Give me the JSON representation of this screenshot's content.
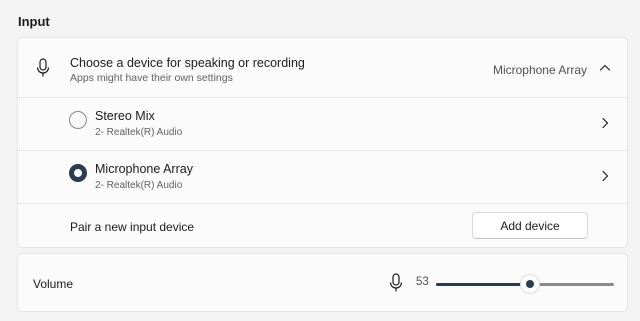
{
  "section": {
    "title": "Input"
  },
  "device_select": {
    "title": "Choose a device for speaking or recording",
    "subtitle": "Apps might have their own settings",
    "selected_value": "Microphone Array"
  },
  "devices": [
    {
      "name": "Stereo Mix",
      "detail": "2- Realtek(R) Audio",
      "selected": false
    },
    {
      "name": "Microphone Array",
      "detail": "2- Realtek(R) Audio",
      "selected": true
    }
  ],
  "pair": {
    "label": "Pair a new input device",
    "button_label": "Add device"
  },
  "volume": {
    "label": "Volume",
    "value": "53",
    "level": 0.53
  },
  "colors": {
    "accent": "#2b3c4f",
    "card_bg": "#fbfbfb",
    "page_bg": "#f3f3f3"
  },
  "icons": {
    "header": "microphone-icon",
    "expand": "chevron-up-icon",
    "row": "chevron-right-icon",
    "volume": "microphone-icon"
  }
}
